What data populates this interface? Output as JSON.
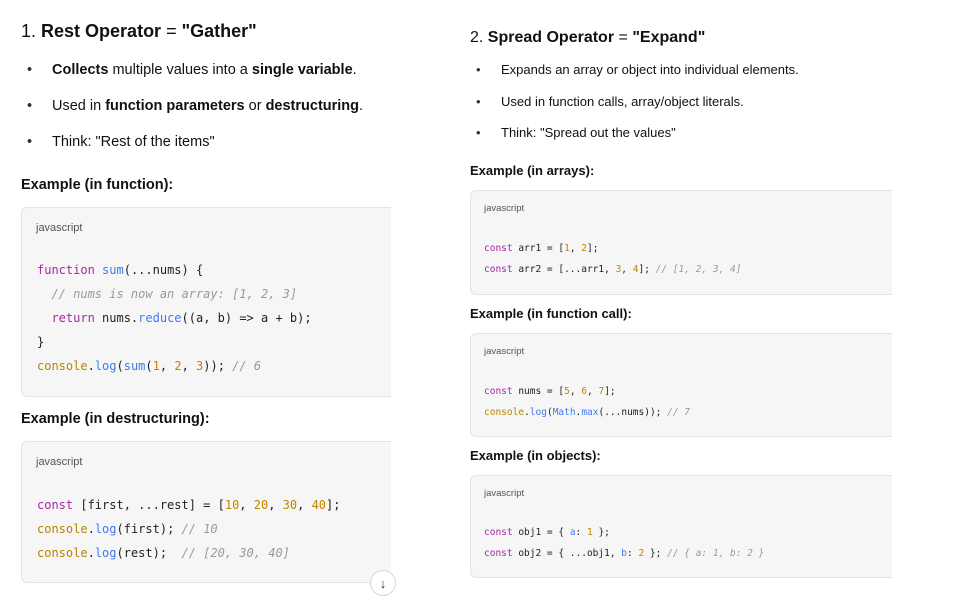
{
  "rest": {
    "num": "1.",
    "title_strong": "Rest Operator",
    "title_eq": "=",
    "title_quote": "\"Gather\"",
    "bullets": [
      {
        "b": "Collects",
        "t1": " multiple values into a ",
        "b2": "single variable",
        "t2": "."
      },
      {
        "t0": "Used in ",
        "b": "function parameters",
        "t1": " or ",
        "b2": "destructuring",
        "t2": "."
      },
      {
        "t0": "Think: \"Rest of the items\""
      }
    ],
    "example1_label": "Example (in function):",
    "example2_label": "Example (in destructuring):",
    "lang": "javascript"
  },
  "spread": {
    "num": "2.",
    "title_strong": "Spread Operator",
    "title_eq": "=",
    "title_quote": "\"Expand\"",
    "bullets": [
      {
        "t0": "Expands an array or object into individual elements."
      },
      {
        "t0": "Used in function calls, array/object literals."
      },
      {
        "t0": "Think: \"Spread out the values\""
      }
    ],
    "example1_label": "Example (in arrays):",
    "example2_label": "Example (in function call):",
    "example3_label": "Example (in objects):",
    "lang": "javascript"
  },
  "download_icon": "download-arrow-icon"
}
